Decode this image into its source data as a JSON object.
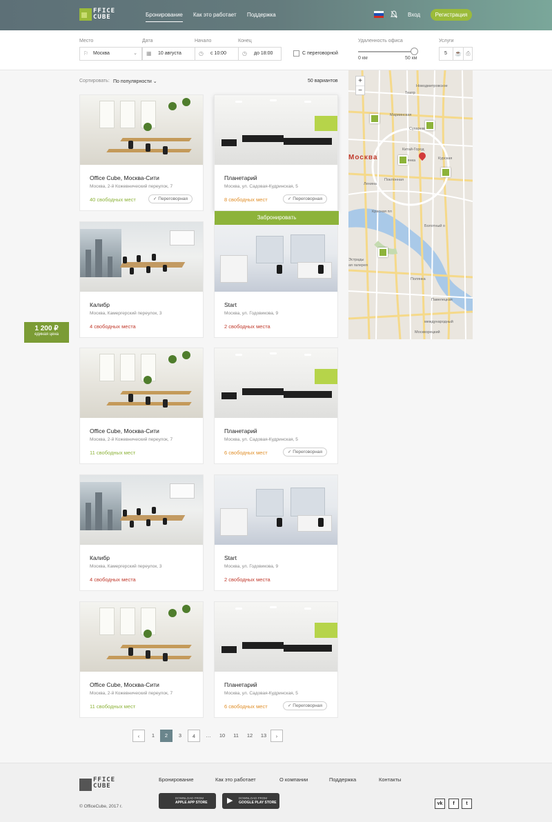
{
  "header": {
    "logo_text_1": "FFICE",
    "logo_text_2": "CUBE",
    "nav": [
      "Бронирование",
      "Как это работает",
      "Поддержка"
    ],
    "login": "Вход",
    "register": "Регистрация",
    "flag_colors": [
      "#ffffff",
      "#1f4fb4",
      "#d52b1e"
    ]
  },
  "filters": {
    "place_label": "Место",
    "place_value": "Москва",
    "date_label": "Дата",
    "date_value": "10 августа",
    "start_label": "Начало",
    "start_value": "с 10:00",
    "end_label": "Конец",
    "end_value": "до 18:00",
    "meeting_checkbox": "С переговорной",
    "distance_label": "Удаленность офиса",
    "distance_min": "0 км",
    "distance_max": "50 км",
    "distance_fraction": 1.0,
    "services_label": "Услуги",
    "services_value": "5"
  },
  "list": {
    "sort_label": "Сортировать:",
    "sort_value": "По популярности",
    "count": "50 вариантов",
    "book_button": "Забронировать",
    "cards": [
      {
        "name": "Office Cube, Москва-Сити",
        "address": "Москва, 2-й Кожевнический переулок, 7",
        "seats": "40 свободных мест",
        "seats_color": "green",
        "tag": "Переговорная",
        "image": "office"
      },
      {
        "name": "Планетарий",
        "address": "Москва, ул. Садовая-Кудринская, 5",
        "seats": "8 свободных мест",
        "seats_color": "orange",
        "tag": "Переговорная",
        "image": "plan"
      },
      {
        "name": "Калибр",
        "address": "Москва, Камергерский переулок, 3",
        "seats": "4 свободных места",
        "seats_color": "red",
        "tag": "",
        "image": "calib"
      },
      {
        "name": "Start",
        "address": "Москва, ул. Годовикова, 9",
        "seats": "2 свободных места",
        "seats_color": "red",
        "tag": "",
        "image": "start"
      },
      {
        "name": "Office Cube, Москва-Сити",
        "address": "Москва, 2-й Кожевнический переулок, 7",
        "seats": "11 свободных мест",
        "seats_color": "green",
        "tag": "",
        "image": "office"
      },
      {
        "name": "Планетарий",
        "address": "Москва, ул. Садовая-Кудринская, 5",
        "seats": "6 свободных мест",
        "seats_color": "orange",
        "tag": "Переговорная",
        "image": "plan"
      },
      {
        "name": "Калибр",
        "address": "Москва, Камергерский переулок, 3",
        "seats": "4 свободных места",
        "seats_color": "red",
        "tag": "",
        "image": "calib"
      },
      {
        "name": "Start",
        "address": "Москва, ул. Годовикова, 9",
        "seats": "2 свободных места",
        "seats_color": "red",
        "tag": "",
        "image": "start"
      },
      {
        "name": "Office Cube, Москва-Сити",
        "address": "Москва, 2-й Кожевнический переулок, 7",
        "seats": "11 свободных мест",
        "seats_color": "green",
        "tag": "",
        "image": "office"
      },
      {
        "name": "Планетарий",
        "address": "Москва, ул. Садовая-Кудринская, 5",
        "seats": "6 свободных мест",
        "seats_color": "orange",
        "tag": "Переговорная",
        "image": "plan"
      }
    ]
  },
  "price_badge": {
    "value": "1 200 ₽",
    "caption": "единая цена"
  },
  "map": {
    "city": "Москва",
    "zoom_in": "+",
    "zoom_out": "−",
    "labels": [
      "Новодмитровское",
      "Театр",
      "Сухаревская",
      "Мариинская",
      "Китай-Город",
      "Поклонная",
      "Курская",
      "Лубянка",
      "Ленина",
      "Болотный о",
      "Эстрады",
      "ая галерея",
      "Красная пл",
      "Полянка",
      "международный",
      "Павелецкая",
      "Москворецкий"
    ],
    "marker_color": "#8db33a",
    "pin_color": "#d23a3a"
  },
  "pagination": {
    "prev": "‹",
    "next": "›",
    "pages": [
      "1",
      "2",
      "3",
      "4",
      "…",
      "10",
      "11",
      "12",
      "13"
    ],
    "active": "2"
  },
  "footer": {
    "logo_text_1": "FFICE",
    "logo_text_2": "CUBE",
    "links": [
      "Бронирование",
      "Как это работает",
      "О компании",
      "Поддержка",
      "Контакты"
    ],
    "copyright": "© OfficeCube, 2017 г.",
    "app_store_small": "DOWNLOAD FROM",
    "app_store_big": "APPLE APP STORE",
    "play_store_small": "DOWNLOAD FROM",
    "play_store_big": "GOOGLE PLAY STORE",
    "social": [
      "vk",
      "f",
      "t"
    ]
  }
}
